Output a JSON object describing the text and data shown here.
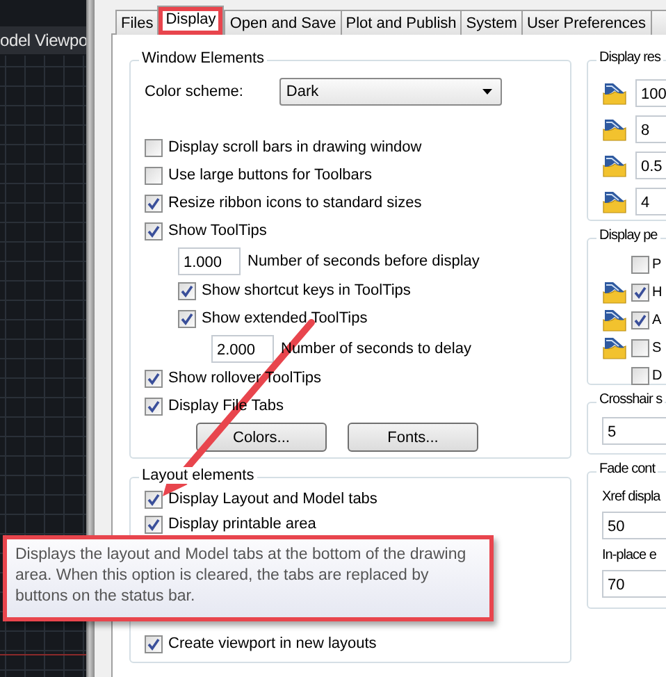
{
  "drawing_pane": {
    "title": "odel Viewpo"
  },
  "tabs": [
    {
      "label": "Files",
      "selected": false,
      "highlighted": false
    },
    {
      "label": "Display",
      "selected": true,
      "highlighted": true
    },
    {
      "label": "Open and Save",
      "selected": false,
      "highlighted": false
    },
    {
      "label": "Plot and Publish",
      "selected": false,
      "highlighted": false
    },
    {
      "label": "System",
      "selected": false,
      "highlighted": false
    },
    {
      "label": "User Preferences",
      "selected": false,
      "highlighted": false
    }
  ],
  "window_elements": {
    "title": "Window Elements",
    "color_scheme": {
      "label": "Color scheme:",
      "value": "Dark"
    },
    "options": [
      {
        "kind": "check",
        "label": "Display scroll bars in drawing window",
        "checked": false
      },
      {
        "kind": "check",
        "label": "Use large buttons for Toolbars",
        "checked": false
      },
      {
        "kind": "check",
        "label": "Resize ribbon icons to standard sizes",
        "checked": true
      },
      {
        "kind": "check",
        "label": "Show ToolTips",
        "checked": true,
        "children": [
          {
            "kind": "number",
            "value": "1.000",
            "label": "Number of seconds before display"
          },
          {
            "kind": "check",
            "label": "Show shortcut keys in ToolTips",
            "checked": true
          },
          {
            "kind": "check",
            "label": "Show extended ToolTips",
            "checked": true,
            "children": [
              {
                "kind": "number",
                "value": "2.000",
                "label": "Number of seconds to delay"
              }
            ]
          }
        ]
      },
      {
        "kind": "check",
        "label": "Show rollover ToolTips",
        "checked": true
      },
      {
        "kind": "check",
        "label": "Display File Tabs",
        "checked": true
      }
    ],
    "buttons": [
      "Colors...",
      "Fonts..."
    ]
  },
  "layout_elements": {
    "title": "Layout elements",
    "options": [
      {
        "kind": "check",
        "label": "Display Layout and Model tabs",
        "checked": true
      },
      {
        "kind": "check",
        "label": "Display printable area",
        "checked": true
      },
      {
        "kind": "check",
        "label": "Create viewport in new layouts",
        "checked": true
      }
    ]
  },
  "tooltip": {
    "text": "Displays the layout and Model tabs at the bottom of the drawing area. When this option is cleared, the tabs are replaced by buttons on the status bar."
  },
  "display_resolution": {
    "title": "Display res",
    "fields": [
      "100",
      "8",
      "0.5",
      "4"
    ]
  },
  "display_performance": {
    "title": "Display pe",
    "options": [
      {
        "label": "P",
        "checked": false,
        "icon": false
      },
      {
        "label": "H",
        "checked": true,
        "icon": true
      },
      {
        "label": "A",
        "checked": true,
        "icon": true
      },
      {
        "label": "S",
        "checked": false,
        "icon": true
      },
      {
        "label": "D",
        "checked": false,
        "icon": false
      }
    ]
  },
  "crosshair_size": {
    "title": "Crosshair s",
    "value": "5"
  },
  "fade_control": {
    "title": "Fade cont",
    "fields": [
      {
        "label": "Xref displa",
        "value": "50"
      },
      {
        "label": "In-place e",
        "value": "70"
      }
    ]
  }
}
